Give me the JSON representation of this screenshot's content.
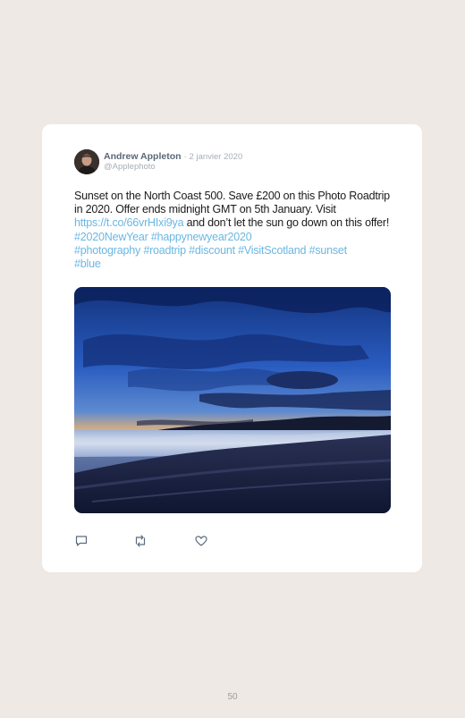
{
  "tweet": {
    "author_name": "Andrew Appleton",
    "separator": "·",
    "date": "2 janvier 2020",
    "handle": "@Applephoto",
    "text_part1": "Sunset on the North Coast 500. Save £200 on this Photo Roadtrip in 2020. Offer ends midnight GMT on 5th January. Visit ",
    "link": "https://t.co/66vrHIxi9ya",
    "text_part2": " and don’t let the sun go down on this offer! ",
    "hashtags_line1": "#2020NewYear #happynewyear2020",
    "hashtags_line2": "#photography #roadtrip #discount #VisitScotland #sunset",
    "hashtags_line3": "#blue",
    "link_color": "#6ab7e3",
    "icons": [
      "reply-icon",
      "retweet-icon",
      "like-icon"
    ]
  },
  "page": {
    "number": "50",
    "background": "#efe9e5"
  }
}
